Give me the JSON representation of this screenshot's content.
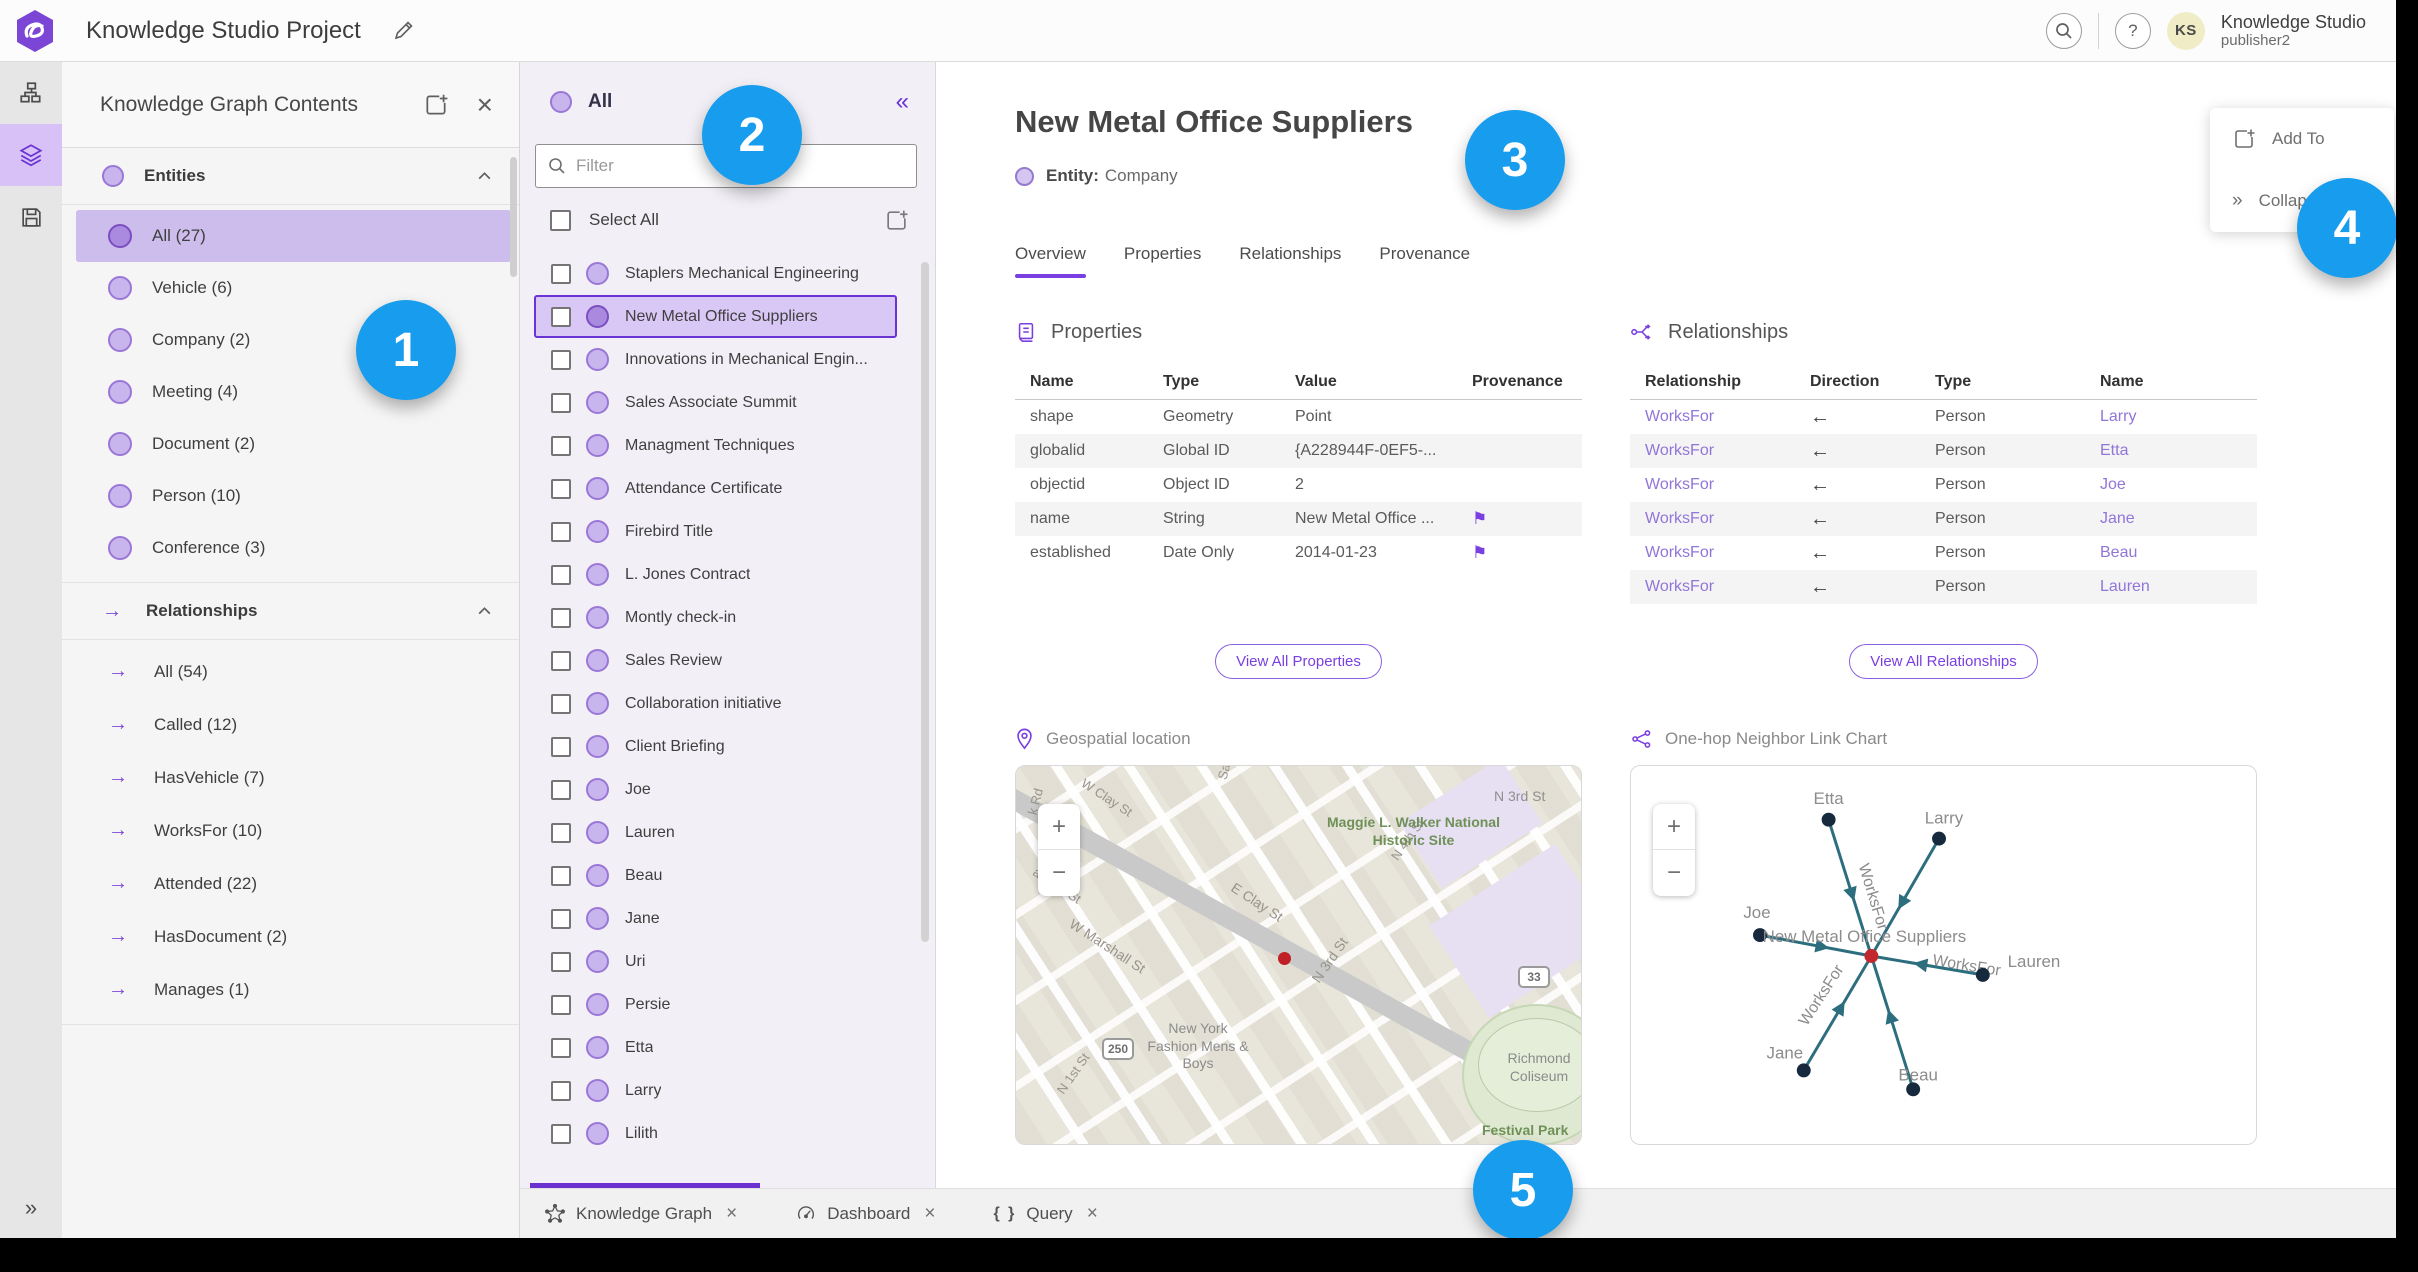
{
  "top_bar": {
    "title": "Knowledge Studio Project",
    "help_glyph": "?",
    "avatar_initials": "KS",
    "user_name": "Knowledge Studio",
    "user_role": "publisher2"
  },
  "rail": {
    "expand_glyph": "»"
  },
  "left_panel": {
    "title": "Knowledge Graph Contents",
    "close_glyph": "×",
    "entities": {
      "label": "Entities",
      "items": [
        {
          "label": "All (27)"
        },
        {
          "label": "Vehicle (6)"
        },
        {
          "label": "Company (2)"
        },
        {
          "label": "Meeting (4)"
        },
        {
          "label": "Document (2)"
        },
        {
          "label": "Person (10)"
        },
        {
          "label": "Conference (3)"
        }
      ]
    },
    "relationships": {
      "label": "Relationships",
      "arrow_glyph": "→",
      "items": [
        {
          "label": "All (54)"
        },
        {
          "label": "Called (12)"
        },
        {
          "label": "HasVehicle (7)"
        },
        {
          "label": "WorksFor (10)"
        },
        {
          "label": "Attended (22)"
        },
        {
          "label": "HasDocument (2)"
        },
        {
          "label": "Manages (1)"
        }
      ]
    }
  },
  "list_panel": {
    "header": "All",
    "collapse_glyph": "«",
    "filter_placeholder": "Filter",
    "select_all": "Select All",
    "items": [
      {
        "label": "Staplers Mechanical Engineering"
      },
      {
        "label": "New Metal Office Suppliers"
      },
      {
        "label": "Innovations in Mechanical Engin..."
      },
      {
        "label": "Sales Associate Summit"
      },
      {
        "label": "Managment Techniques"
      },
      {
        "label": "Attendance Certificate"
      },
      {
        "label": "Firebird Title"
      },
      {
        "label": "L. Jones Contract"
      },
      {
        "label": "Montly check-in"
      },
      {
        "label": "Sales Review"
      },
      {
        "label": "Collaboration initiative"
      },
      {
        "label": "Client Briefing"
      },
      {
        "label": "Joe"
      },
      {
        "label": "Lauren"
      },
      {
        "label": "Beau"
      },
      {
        "label": "Jane"
      },
      {
        "label": "Uri"
      },
      {
        "label": "Persie"
      },
      {
        "label": "Etta"
      },
      {
        "label": "Larry"
      },
      {
        "label": "Lilith"
      }
    ]
  },
  "detail": {
    "title": "New Metal Office Suppliers",
    "entity_label": "Entity:",
    "entity_type": "Company",
    "tabs": [
      "Overview",
      "Properties",
      "Relationships",
      "Provenance"
    ],
    "properties": {
      "title": "Properties",
      "columns": [
        "Name",
        "Type",
        "Value",
        "Provenance"
      ],
      "rows": [
        {
          "name": "shape",
          "type": "Geometry",
          "value": "Point",
          "prov": ""
        },
        {
          "name": "globalid",
          "type": "Global ID",
          "value": "{A228944F-0EF5-...",
          "prov": ""
        },
        {
          "name": "objectid",
          "type": "Object ID",
          "value": "2",
          "prov": ""
        },
        {
          "name": "name",
          "type": "String",
          "value": "New Metal Office ...",
          "prov": "⚑"
        },
        {
          "name": "established",
          "type": "Date Only",
          "value": "2014-01-23",
          "prov": "⚑"
        }
      ],
      "view_all": "View All Properties"
    },
    "relationships": {
      "title": "Relationships",
      "columns": [
        "Relationship",
        "Direction",
        "Type",
        "Name"
      ],
      "rows": [
        {
          "rel": "WorksFor",
          "dir": "←",
          "type": "Person",
          "name": "Larry"
        },
        {
          "rel": "WorksFor",
          "dir": "←",
          "type": "Person",
          "name": "Etta"
        },
        {
          "rel": "WorksFor",
          "dir": "←",
          "type": "Person",
          "name": "Joe"
        },
        {
          "rel": "WorksFor",
          "dir": "←",
          "type": "Person",
          "name": "Jane"
        },
        {
          "rel": "WorksFor",
          "dir": "←",
          "type": "Person",
          "name": "Beau"
        },
        {
          "rel": "WorksFor",
          "dir": "←",
          "type": "Person",
          "name": "Lauren"
        }
      ],
      "view_all": "View All Relationships"
    },
    "map": {
      "title": "Geospatial location",
      "zoom_in": "+",
      "zoom_out": "−",
      "labels": {
        "k_rd": "k Rd",
        "w_clay": "W Clay St",
        "sa": "Sa",
        "n3rd_top": "N 3rd St",
        "marshall": "arshall St",
        "w_marshall": "W Marshall St",
        "e_clay": "E Clay St",
        "n3rd_mid": "N 3rd St",
        "n4th": "N 4th St",
        "n1st": "N 1st St",
        "maggie": "Maggie L. Walker National Historic Site",
        "ny_fashion": "New York Fashion Mens & Boys",
        "coliseum": "Richmond Coliseum",
        "festival": "Festival Park",
        "shield_250": "250",
        "shield_33": "33"
      }
    },
    "link_chart": {
      "title": "One-hop Neighbor Link Chart",
      "zoom_in": "+",
      "zoom_out": "−",
      "center_label": "New Metal Office Suppliers",
      "edge_label": "WorksFor",
      "nodes": [
        "Etta",
        "Larry",
        "Joe",
        "Lauren",
        "Jane",
        "Beau"
      ]
    }
  },
  "popover": {
    "add_to": "Add To",
    "collapse": "Collapse",
    "expand_glyph": "»"
  },
  "bottom_bar": {
    "close_glyph": "×",
    "tabs": [
      {
        "label": "Knowledge Graph"
      },
      {
        "label": "Dashboard"
      },
      {
        "label": "Query",
        "icon": "{ }"
      }
    ]
  },
  "callouts": [
    "1",
    "2",
    "3",
    "4",
    "5"
  ],
  "colors": {
    "accent_purple": "#6a33d4",
    "selection_bg": "#d9c8f6",
    "callout_blue": "#189ced",
    "edge_teal": "#2d6e7e",
    "node_navy": "#16293d",
    "center_red": "#c1272d"
  }
}
